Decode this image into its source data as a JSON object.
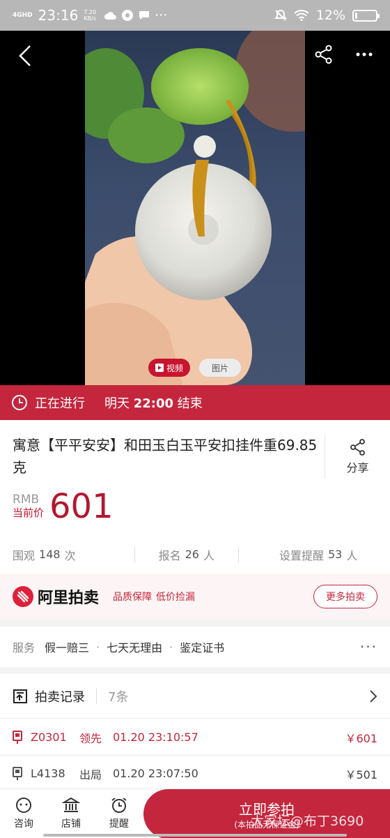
{
  "status_bar": {
    "network": "4GHD",
    "time": "23:16",
    "speed_value": "7.20",
    "speed_unit": "KB/s",
    "battery": "12%",
    "battery_fraction": 0.12
  },
  "media": {
    "tab_video": "视频",
    "tab_image": "图片"
  },
  "auction_status": {
    "status": "正在进行",
    "end_day": "明天",
    "end_time": "22:00",
    "end_suffix": "结束"
  },
  "product": {
    "title": "寓意【平平安安】和田玉白玉平安扣挂件重69.85克",
    "share_label": "分享",
    "currency": "RMB",
    "price_label": "当前价",
    "price": "601"
  },
  "stats": {
    "views_label": "围观",
    "views": "148",
    "views_unit": "次",
    "signups_label": "报名",
    "signups": "26",
    "signups_unit": "人",
    "reminders_label": "设置提醒",
    "reminders": "53",
    "reminders_unit": "人"
  },
  "ali": {
    "name": "阿里拍卖",
    "tag1": "品质保障",
    "tag2": "低价捡漏",
    "more_button": "更多拍卖"
  },
  "services": {
    "label": "服务",
    "items": [
      "假一赔三",
      "七天无理由",
      "鉴定证书"
    ]
  },
  "records": {
    "title": "拍卖记录",
    "count": "7条",
    "bids": [
      {
        "bidder": "Z0301",
        "state": "领先",
        "time": "01.20 23:10:57",
        "amount": "￥601"
      },
      {
        "bidder": "L4138",
        "state": "出局",
        "time": "01.20 23:07:50",
        "amount": "￥501"
      }
    ]
  },
  "bottom_bar": {
    "consult": "咨询",
    "shop": "店铺",
    "remind": "提醒",
    "join": "立即参拍",
    "join_sub": "(本拍品无保证金)",
    "watermark": "大家坛@布丁3690"
  }
}
